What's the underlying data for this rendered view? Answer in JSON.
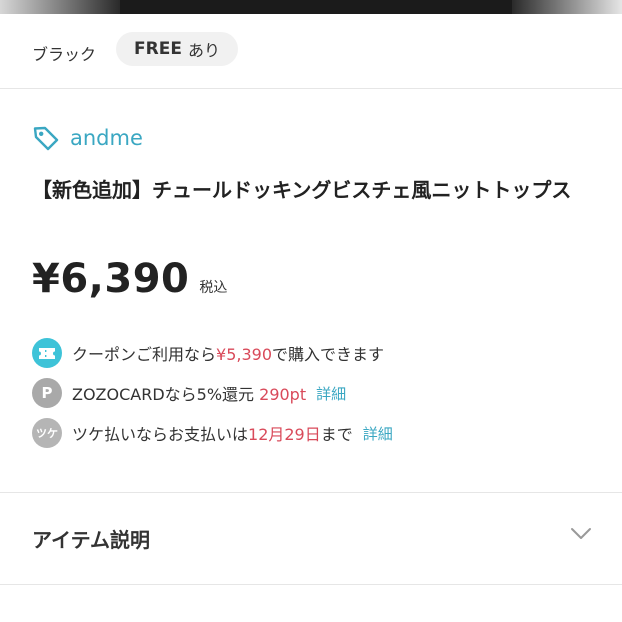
{
  "variant": {
    "color": "ブラック",
    "size_main": "FREE",
    "size_status": "あり"
  },
  "brand": {
    "name": "andme"
  },
  "product": {
    "title": "【新色追加】チュールドッキングビスチェ風ニットトップス",
    "price": "¥6,390",
    "tax_label": "税込"
  },
  "benefits": [
    {
      "icon": "coupon-ticket-icon",
      "before": "クーポンご利用なら",
      "highlight": "¥5,390",
      "after": "で購入できます",
      "link": ""
    },
    {
      "icon": "point-p-icon",
      "before": "ZOZOCARDなら5%還元 ",
      "highlight": "290pt",
      "after": "",
      "link": "詳細"
    },
    {
      "icon": "tsuke-payment-icon",
      "before": "ツケ払いならお支払いは",
      "highlight": "12月29日",
      "after": "まで",
      "link": "詳細"
    }
  ],
  "icons": {
    "p_glyph": "P",
    "tsuke_glyph": "ツケ"
  },
  "sections": {
    "item_description": "アイテム説明"
  },
  "colors": {
    "accent": "#3aa7c2",
    "highlight": "#d94a5a"
  }
}
